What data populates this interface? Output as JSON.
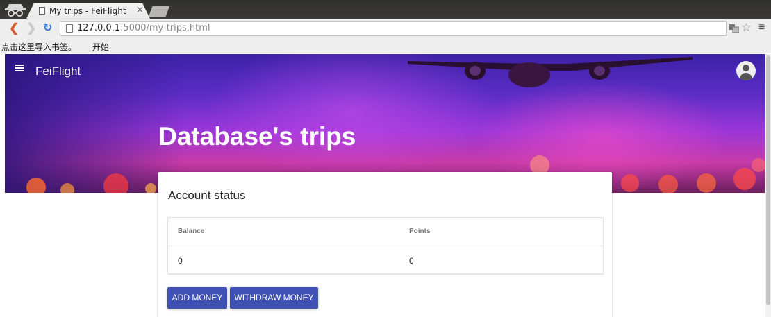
{
  "browser": {
    "tab_title": "My trips - FeiFlight",
    "tab_close": "×",
    "url_host": "127.0.0.1",
    "url_rest": ":5000/my-trips.html",
    "bookmarks_hint": "点击这里导入书签。",
    "bookmarks_start": "开始"
  },
  "app": {
    "brand": "FeiFlight",
    "page_title": "Database's trips"
  },
  "account": {
    "title": "Account status",
    "columns": [
      "Balance",
      "Points"
    ],
    "values": [
      "0",
      "0"
    ],
    "add_money_label": "ADD MONEY",
    "withdraw_money_label": "WITHDRAW MONEY"
  },
  "colors": {
    "accent": "#3f51b5",
    "hero_top": "#3b22a6",
    "hero_bottom": "#c73aa8"
  },
  "icons": {
    "menu": "hamburger-icon",
    "avatar": "account-circle-icon",
    "back": "back-arrow-icon",
    "forward": "forward-arrow-icon",
    "reload": "reload-icon",
    "star": "star-icon",
    "browser_menu": "chrome-menu-icon"
  }
}
